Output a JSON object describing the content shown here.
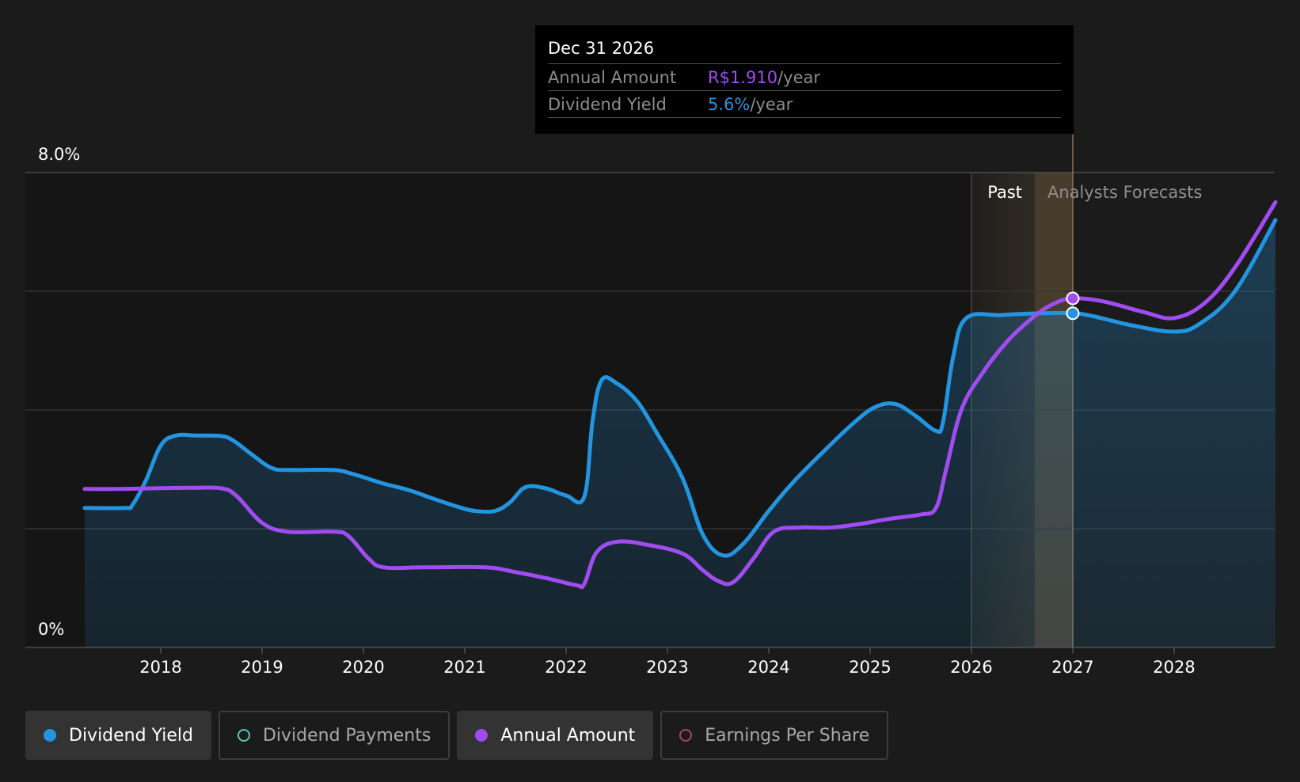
{
  "colors": {
    "background": "#1b1b1b",
    "dividend_yield": "#2394df",
    "annual_amount": "#a04cf0",
    "dividend_payments": "#5bc7b5",
    "earnings_per_share": "#a8426c",
    "forecast_highlight": "#c99a5a"
  },
  "tooltip": {
    "date": "Dec 31 2026",
    "rows": [
      {
        "label": "Annual Amount",
        "value": "R$1.910",
        "unit": "/year",
        "color": "#a04cf0"
      },
      {
        "label": "Dividend Yield",
        "value": "5.6%",
        "unit": "/year",
        "color": "#2394df"
      }
    ]
  },
  "legend": [
    {
      "label": "Dividend Yield",
      "active": true,
      "icon": "filled-circle-icon",
      "color": "#2394df"
    },
    {
      "label": "Dividend Payments",
      "active": false,
      "icon": "hollow-circle-icon",
      "color": "#5bc7b5"
    },
    {
      "label": "Annual Amount",
      "active": true,
      "icon": "filled-circle-icon",
      "color": "#a04cf0"
    },
    {
      "label": "Earnings Per Share",
      "active": false,
      "icon": "hollow-circle-icon",
      "color": "#a8426c"
    }
  ],
  "chart_data": {
    "type": "line",
    "y_tick_labels": [
      "8.0%",
      "0%"
    ],
    "ylim": [
      0,
      8.0
    ],
    "xlim": [
      2017.25,
      2029.0
    ],
    "x_tick_labels": [
      "2018",
      "2019",
      "2020",
      "2021",
      "2022",
      "2023",
      "2024",
      "2025",
      "2026",
      "2027",
      "2028"
    ],
    "region_labels": {
      "past": "Past",
      "forecast": "Analysts Forecasts"
    },
    "past_forecast_boundary": 2026.0,
    "highlighted_x": 2027.0,
    "grid": true,
    "series": [
      {
        "name": "Dividend Yield",
        "filled": true,
        "points": [
          [
            2017.25,
            2.35
          ],
          [
            2017.65,
            2.35
          ],
          [
            2017.72,
            2.4
          ],
          [
            2017.85,
            2.8
          ],
          [
            2018.0,
            3.4
          ],
          [
            2018.15,
            3.57
          ],
          [
            2018.35,
            3.57
          ],
          [
            2018.6,
            3.56
          ],
          [
            2018.72,
            3.48
          ],
          [
            2018.9,
            3.25
          ],
          [
            2019.1,
            3.02
          ],
          [
            2019.3,
            2.99
          ],
          [
            2019.7,
            2.99
          ],
          [
            2019.9,
            2.92
          ],
          [
            2020.2,
            2.76
          ],
          [
            2020.45,
            2.65
          ],
          [
            2020.7,
            2.5
          ],
          [
            2020.95,
            2.36
          ],
          [
            2021.1,
            2.3
          ],
          [
            2021.3,
            2.3
          ],
          [
            2021.45,
            2.45
          ],
          [
            2021.6,
            2.7
          ],
          [
            2021.8,
            2.68
          ],
          [
            2022.0,
            2.56
          ],
          [
            2022.18,
            2.54
          ],
          [
            2022.26,
            3.8
          ],
          [
            2022.35,
            4.5
          ],
          [
            2022.5,
            4.45
          ],
          [
            2022.7,
            4.15
          ],
          [
            2022.9,
            3.6
          ],
          [
            2023.15,
            2.85
          ],
          [
            2023.35,
            1.9
          ],
          [
            2023.55,
            1.55
          ],
          [
            2023.75,
            1.75
          ],
          [
            2024.0,
            2.3
          ],
          [
            2024.25,
            2.8
          ],
          [
            2024.6,
            3.4
          ],
          [
            2024.85,
            3.8
          ],
          [
            2025.05,
            4.05
          ],
          [
            2025.25,
            4.1
          ],
          [
            2025.45,
            3.9
          ],
          [
            2025.65,
            3.65
          ],
          [
            2025.72,
            3.8
          ],
          [
            2025.82,
            4.9
          ],
          [
            2025.95,
            5.55
          ],
          [
            2026.3,
            5.6
          ],
          [
            2026.7,
            5.63
          ],
          [
            2027.0,
            5.63
          ],
          [
            2027.2,
            5.58
          ],
          [
            2027.6,
            5.42
          ],
          [
            2028.0,
            5.32
          ],
          [
            2028.25,
            5.45
          ],
          [
            2028.6,
            6.0
          ],
          [
            2029.0,
            7.2
          ]
        ]
      },
      {
        "name": "Annual Amount",
        "filled": false,
        "points": [
          [
            2017.25,
            2.67
          ],
          [
            2017.6,
            2.67
          ],
          [
            2017.9,
            2.68
          ],
          [
            2018.3,
            2.69
          ],
          [
            2018.6,
            2.68
          ],
          [
            2018.75,
            2.55
          ],
          [
            2019.0,
            2.1
          ],
          [
            2019.25,
            1.95
          ],
          [
            2019.7,
            1.95
          ],
          [
            2019.85,
            1.88
          ],
          [
            2020.05,
            1.5
          ],
          [
            2020.2,
            1.35
          ],
          [
            2020.6,
            1.35
          ],
          [
            2021.2,
            1.35
          ],
          [
            2021.5,
            1.27
          ],
          [
            2021.8,
            1.17
          ],
          [
            2022.1,
            1.05
          ],
          [
            2022.18,
            1.07
          ],
          [
            2022.3,
            1.6
          ],
          [
            2022.5,
            1.78
          ],
          [
            2022.8,
            1.73
          ],
          [
            2023.15,
            1.58
          ],
          [
            2023.35,
            1.3
          ],
          [
            2023.5,
            1.12
          ],
          [
            2023.65,
            1.1
          ],
          [
            2023.85,
            1.5
          ],
          [
            2024.05,
            1.95
          ],
          [
            2024.3,
            2.02
          ],
          [
            2024.6,
            2.02
          ],
          [
            2024.9,
            2.08
          ],
          [
            2025.2,
            2.17
          ],
          [
            2025.5,
            2.24
          ],
          [
            2025.65,
            2.35
          ],
          [
            2025.75,
            3.0
          ],
          [
            2025.9,
            4.0
          ],
          [
            2026.1,
            4.6
          ],
          [
            2026.35,
            5.15
          ],
          [
            2026.6,
            5.55
          ],
          [
            2026.8,
            5.78
          ],
          [
            2027.0,
            5.88
          ],
          [
            2027.3,
            5.83
          ],
          [
            2027.7,
            5.65
          ],
          [
            2028.0,
            5.55
          ],
          [
            2028.3,
            5.8
          ],
          [
            2028.6,
            6.4
          ],
          [
            2029.0,
            7.5
          ]
        ]
      }
    ]
  }
}
